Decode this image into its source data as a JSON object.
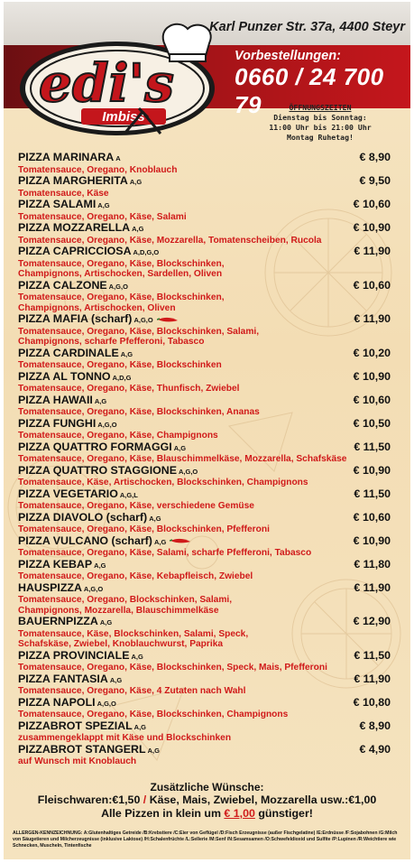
{
  "header": {
    "address": "Karl Punzer Str. 37a, 4400 Steyr",
    "preorder_label": "Vorbestellungen:",
    "phone": "0660 / 24 700 79",
    "logo_text": "edi's",
    "logo_subtext": "Imbiss",
    "hours_title": "ÖFFNUNGSZEITEN",
    "hours_line1": "Dienstag bis Sonntag:",
    "hours_line2": "11:00 Uhr bis 21:00 Uhr",
    "hours_line3": "Montag Ruhetag!"
  },
  "menu": [
    {
      "name": "PIZZA MARINARA",
      "allergens": "A",
      "price": "€ 8,90",
      "desc": [
        "Tomatensauce, Oregano, Knoblauch"
      ],
      "chili": false
    },
    {
      "name": "PIZZA MARGHERITA",
      "allergens": "A,G",
      "price": "€ 9,50",
      "desc": [
        "Tomatensauce, Käse"
      ],
      "chili": false
    },
    {
      "name": "PIZZA SALAMI",
      "allergens": "A,G",
      "price": "€ 10,60",
      "desc": [
        "Tomatensauce, Oregano, Käse, Salami"
      ],
      "chili": false
    },
    {
      "name": "PIZZA MOZZARELLA",
      "allergens": "A,G",
      "price": "€ 10,90",
      "desc": [
        "Tomatensauce, Oregano, Käse, Mozzarella, Tomatenscheiben, Rucola"
      ],
      "chili": false
    },
    {
      "name": "PIZZA CAPRICCIOSA",
      "allergens": "A,D,G,O",
      "price": "€ 11,90",
      "desc": [
        "Tomatensauce, Oregano, Käse, Blockschinken,",
        "Champignons, Artischocken, Sardellen, Oliven"
      ],
      "chili": false
    },
    {
      "name": "PIZZA CALZONE",
      "allergens": "A,G,O",
      "price": "€ 10,60",
      "desc": [
        "Tomatensauce, Oregano, Käse, Blockschinken,",
        "Champignons, Artischocken, Oliven"
      ],
      "chili": false
    },
    {
      "name": "PIZZA MAFIA (scharf)",
      "allergens": "A,G,O",
      "price": "€ 11,90",
      "desc": [
        "Tomatensauce, Oregano, Käse, Blockschinken, Salami,",
        "Champignons, scharfe Pfefferoni, Tabasco"
      ],
      "chili": true
    },
    {
      "name": "PIZZA CARDINALE",
      "allergens": "A,G",
      "price": "€ 10,20",
      "desc": [
        "Tomatensauce, Oregano, Käse, Blockschinken"
      ],
      "chili": false
    },
    {
      "name": "PIZZA AL TONNO",
      "allergens": "A,D,G",
      "price": "€ 10,90",
      "desc": [
        "Tomatensauce, Oregano, Käse, Thunfisch, Zwiebel"
      ],
      "chili": false
    },
    {
      "name": "PIZZA HAWAII",
      "allergens": "A,G",
      "price": "€ 10,60",
      "desc": [
        "Tomatensauce, Oregano, Käse, Blockschinken, Ananas"
      ],
      "chili": false
    },
    {
      "name": "PIZZA FUNGHI",
      "allergens": "A,G,O",
      "price": "€ 10,50",
      "desc": [
        "Tomatensauce, Oregano, Käse, Champignons"
      ],
      "chili": false
    },
    {
      "name": "PIZZA QUATTRO FORMAGGI",
      "allergens": "A,G",
      "price": "€ 11,50",
      "desc": [
        "Tomatensauce, Oregano, Käse, Blauschimmelkäse, Mozzarella, Schafskäse"
      ],
      "chili": false
    },
    {
      "name": "PIZZA QUATTRO STAGGIONE",
      "allergens": "A,G,O",
      "price": "€ 10,90",
      "desc": [
        "Tomatensauce, Käse, Artischocken, Blockschinken, Champignons"
      ],
      "chili": false
    },
    {
      "name": "PIZZA VEGETARIO",
      "allergens": "A,G,L",
      "price": "€ 11,50",
      "desc": [
        "Tomatensauce, Oregano, Käse, verschiedene Gemüse"
      ],
      "chili": false
    },
    {
      "name": "PIZZA DIAVOLO (scharf)",
      "allergens": "A,G",
      "price": "€ 10,60",
      "desc": [
        "Tomatensauce, Oregano, Käse, Blockschinken, Pfefferoni"
      ],
      "chili": false
    },
    {
      "name": "PIZZA VULCANO (scharf)",
      "allergens": "A,G",
      "price": "€ 10,90",
      "desc": [
        "Tomatensauce, Oregano, Käse, Salami, scharfe Pfefferoni, Tabasco"
      ],
      "chili": true
    },
    {
      "name": "PIZZA KEBAP",
      "allergens": "A,G",
      "price": "€ 11,80",
      "desc": [
        "Tomatensauce, Oregano, Käse, Kebapfleisch, Zwiebel"
      ],
      "chili": false
    },
    {
      "name": "HAUSPIZZA",
      "allergens": "A,G,O",
      "price": "€ 11,90",
      "desc": [
        "Tomatensauce, Oregano, Blockschinken, Salami,",
        "Champignons, Mozzarella, Blauschimmelkäse"
      ],
      "chili": false
    },
    {
      "name": "BAUERNPIZZA",
      "allergens": "A,G",
      "price": "€ 12,90",
      "desc": [
        "Tomatensauce, Käse, Blockschinken, Salami, Speck,",
        "Schafskäse, Zwiebel, Knoblauchwurst, Paprika"
      ],
      "chili": false
    },
    {
      "name": "PIZZA PROVINCIALE",
      "allergens": "A,G",
      "price": "€ 11,50",
      "desc": [
        "Tomatensauce, Oregano, Käse, Blockschinken, Speck, Mais, Pfefferoni"
      ],
      "chili": false
    },
    {
      "name": "PIZZA FANTASIA",
      "allergens": "A,G",
      "price": "€ 11,90",
      "desc": [
        "Tomatensauce, Oregano, Käse, 4 Zutaten nach Wahl"
      ],
      "chili": false
    },
    {
      "name": "PIZZA NAPOLI",
      "allergens": "A,G,O",
      "price": "€ 10,80",
      "desc": [
        "Tomatensauce, Oregano, Käse, Blockschinken, Champignons"
      ],
      "chili": false
    },
    {
      "name": "PIZZABROT SPEZIAL",
      "allergens": "A,G",
      "price": "€ 8,90",
      "desc": [
        "zusammengeklappt mit Käse und Blockschinken"
      ],
      "chili": false
    },
    {
      "name": "PIZZABROT STANGERL",
      "allergens": "A,G",
      "price": "€ 4,90",
      "desc": [
        "auf Wunsch mit Knoblauch"
      ],
      "chili": false
    }
  ],
  "extras": {
    "title": "Zusätzliche Wünsche:",
    "line_a": "Fleischwaren:€1,50 ",
    "sep": "/",
    "line_b": " Käse, Mais, Zwiebel, Mozzarella usw.:€1,00",
    "small_pre": "Alle Pizzen in klein um ",
    "small_price": "€ 1,00",
    "small_post": " günstiger!"
  },
  "allergy_text": "ALLERGEN-KENNZEICHNUNG: A:Glutenhaltiges Getreide /B:Krebstiere /C:Eier von Geflügel /D:Fisch Erzeugnisse (außer Fischgelatine) /E:Erdnüsse /F:Sojabohnen /G:Milch von Säugetieren und Milcherzeugnisse (inklusive Laktose) /H:Schalenfrüchte /L:Sellerie /M:Senf /N:Sesamsamen /O:Schwefeldioxid und Sulfite /P:Lupinen /R:Weichtiere wie Schnecken, Muscheln, Tintenfische",
  "colors": {
    "accent_red": "#d01a1a",
    "band_red": "#a11417",
    "background": "#f4e1bb"
  }
}
